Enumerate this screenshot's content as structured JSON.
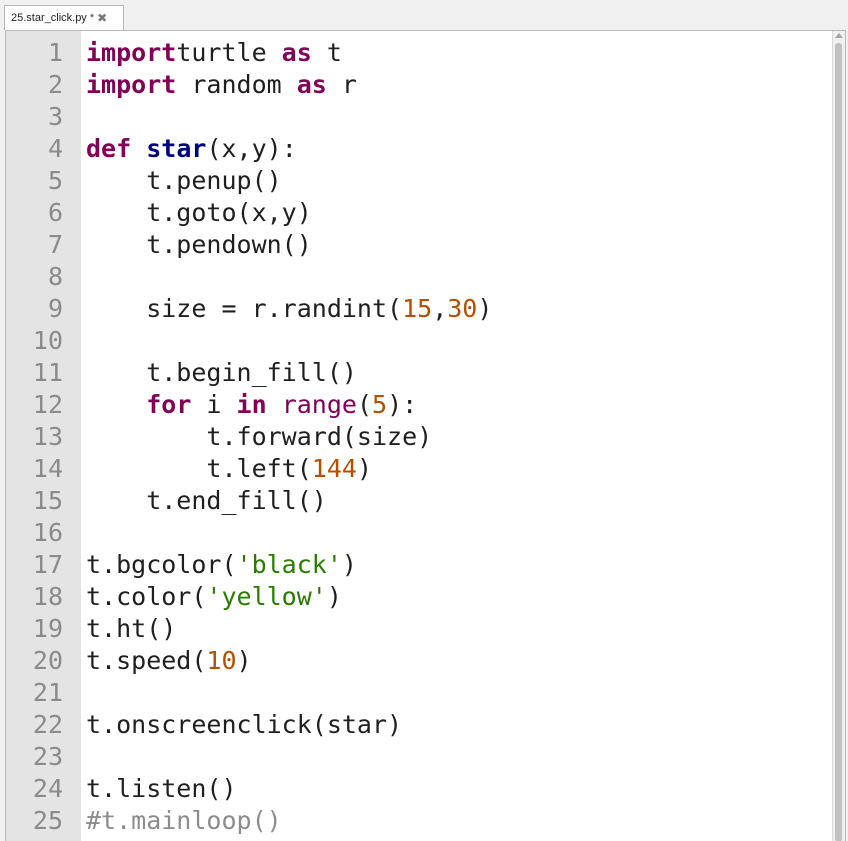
{
  "tab": {
    "filename": "25.star_click.py",
    "dirty_marker": "*",
    "close_icon": "close-icon"
  },
  "editor": {
    "lines": [
      {
        "n": "1",
        "segs": [
          [
            "kw",
            "import"
          ],
          [
            "",
            "turtle "
          ],
          [
            "kw",
            "as"
          ],
          [
            "",
            " t"
          ]
        ]
      },
      {
        "n": "2",
        "segs": [
          [
            "kw",
            "import"
          ],
          [
            "",
            " random "
          ],
          [
            "kw",
            "as"
          ],
          [
            "",
            " r"
          ]
        ]
      },
      {
        "n": "3",
        "segs": []
      },
      {
        "n": "4",
        "segs": [
          [
            "kw",
            "def"
          ],
          [
            "",
            " "
          ],
          [
            "fn",
            "star"
          ],
          [
            "",
            "(x,y):"
          ]
        ]
      },
      {
        "n": "5",
        "segs": [
          [
            "",
            "    t.penup()"
          ]
        ]
      },
      {
        "n": "6",
        "segs": [
          [
            "",
            "    t.goto(x,y)"
          ]
        ]
      },
      {
        "n": "7",
        "segs": [
          [
            "",
            "    t.pendown()"
          ]
        ]
      },
      {
        "n": "8",
        "segs": []
      },
      {
        "n": "9",
        "segs": [
          [
            "",
            "    size = r.randint("
          ],
          [
            "num",
            "15"
          ],
          [
            "",
            ","
          ],
          [
            "num",
            "30"
          ],
          [
            "",
            ")"
          ]
        ]
      },
      {
        "n": "10",
        "segs": []
      },
      {
        "n": "11",
        "segs": [
          [
            "",
            "    t.begin_fill()"
          ]
        ]
      },
      {
        "n": "12",
        "segs": [
          [
            "",
            "    "
          ],
          [
            "kw",
            "for"
          ],
          [
            "",
            " i "
          ],
          [
            "kw",
            "in"
          ],
          [
            "",
            " "
          ],
          [
            "builtin",
            "range"
          ],
          [
            "",
            "("
          ],
          [
            "num",
            "5"
          ],
          [
            "",
            "):"
          ]
        ]
      },
      {
        "n": "13",
        "segs": [
          [
            "",
            "        t.forward(size)"
          ]
        ]
      },
      {
        "n": "14",
        "segs": [
          [
            "",
            "        t.left("
          ],
          [
            "num",
            "144"
          ],
          [
            "",
            ")"
          ]
        ]
      },
      {
        "n": "15",
        "segs": [
          [
            "",
            "    t.end_fill()"
          ]
        ]
      },
      {
        "n": "16",
        "segs": []
      },
      {
        "n": "17",
        "segs": [
          [
            "",
            "t.bgcolor("
          ],
          [
            "str",
            "'black'"
          ],
          [
            "",
            ")"
          ]
        ]
      },
      {
        "n": "18",
        "segs": [
          [
            "",
            "t.color("
          ],
          [
            "str",
            "'yellow'"
          ],
          [
            "",
            ")"
          ]
        ]
      },
      {
        "n": "19",
        "segs": [
          [
            "",
            "t.ht()"
          ]
        ]
      },
      {
        "n": "20",
        "segs": [
          [
            "",
            "t.speed("
          ],
          [
            "num",
            "10"
          ],
          [
            "",
            ")"
          ]
        ]
      },
      {
        "n": "21",
        "segs": []
      },
      {
        "n": "22",
        "segs": [
          [
            "",
            "t.onscreenclick(star)"
          ]
        ]
      },
      {
        "n": "23",
        "segs": []
      },
      {
        "n": "24",
        "segs": [
          [
            "",
            "t.listen()"
          ]
        ]
      },
      {
        "n": "25",
        "segs": [
          [
            "cm",
            "#t.mainloop()"
          ]
        ]
      }
    ]
  },
  "colors": {
    "keyword": "#7f0055",
    "function_name": "#00007f",
    "number": "#b05000",
    "string": "#2a7a00",
    "comment": "#8c8c8c",
    "gutter": "#e4e4e4"
  }
}
